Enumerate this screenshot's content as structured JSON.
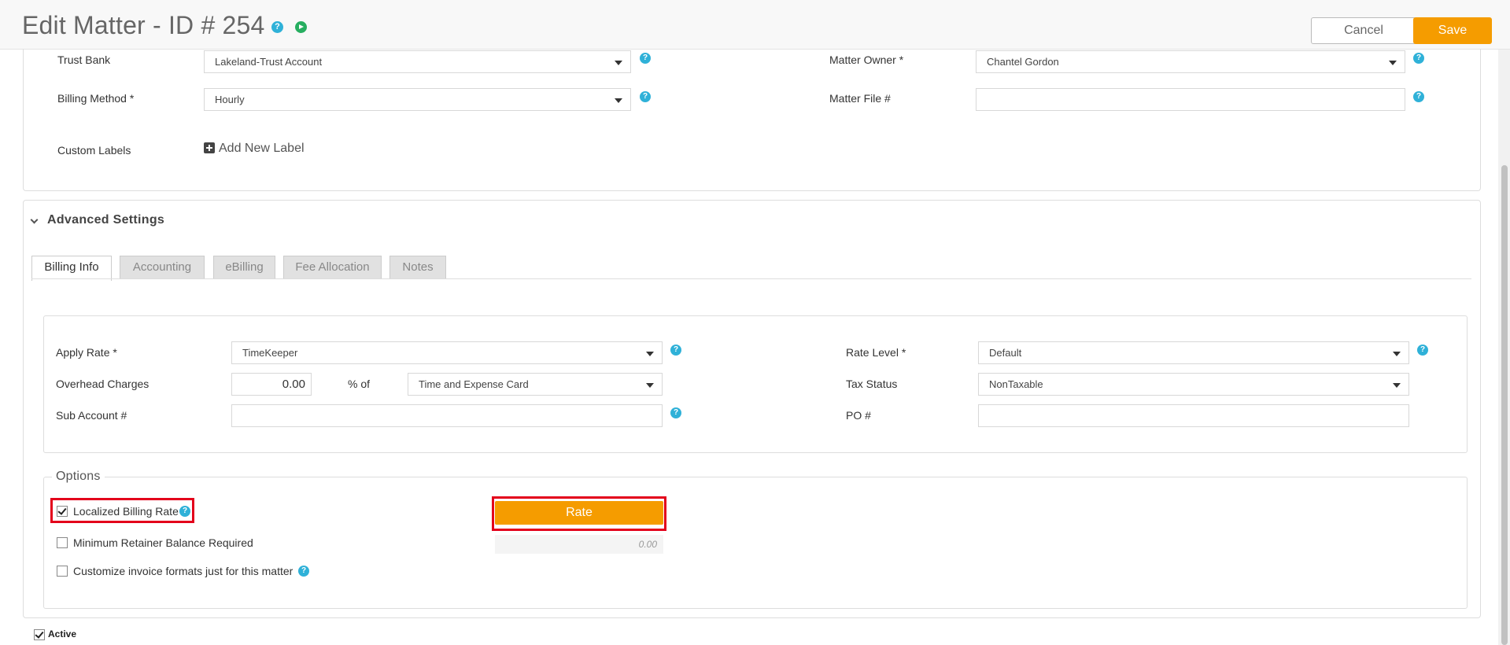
{
  "header": {
    "title": "Edit Matter - ID # 254",
    "cancel_label": "Cancel",
    "save_label": "Save",
    "help_glyph": "?"
  },
  "general": {
    "trust_bank": {
      "label": "Trust Bank",
      "value": "Lakeland-Trust Account"
    },
    "billing_method": {
      "label": "Billing Method *",
      "value": "Hourly"
    },
    "custom_labels": {
      "label": "Custom Labels",
      "add_label": "Add New Label"
    },
    "matter_owner": {
      "label": "Matter Owner *",
      "value": "Chantel Gordon"
    },
    "matter_file": {
      "label": "Matter File #",
      "value": ""
    }
  },
  "advanced": {
    "title": "Advanced Settings",
    "tabs": [
      {
        "label": "Billing Info",
        "active": true
      },
      {
        "label": "Accounting",
        "active": false
      },
      {
        "label": "eBilling",
        "active": false
      },
      {
        "label": "Fee Allocation",
        "active": false
      },
      {
        "label": "Notes",
        "active": false
      }
    ],
    "billing": {
      "apply_rate": {
        "label": "Apply Rate *",
        "value": "TimeKeeper"
      },
      "overhead": {
        "label": "Overhead Charges",
        "value": "0.00",
        "pct_of": "% of",
        "basis": "Time and Expense Card"
      },
      "sub_account": {
        "label": "Sub Account #",
        "value": ""
      },
      "rate_level": {
        "label": "Rate Level *",
        "value": "Default"
      },
      "tax_status": {
        "label": "Tax Status",
        "value": "NonTaxable"
      },
      "po": {
        "label": "PO #",
        "value": ""
      }
    },
    "options": {
      "legend": "Options",
      "localized_billing_rate": {
        "label": "Localized Billing Rate",
        "checked": true
      },
      "min_retainer": {
        "label": "Minimum Retainer Balance Required",
        "checked": false
      },
      "customize_invoice": {
        "label": "Customize invoice formats just for this matter",
        "checked": false
      },
      "rate_button": "Rate",
      "min_retainer_value": "0.00"
    }
  },
  "footer": {
    "active_label": "Active",
    "active_checked": true
  },
  "colors": {
    "accent": "#f59c00",
    "help": "#2fb1d8",
    "highlight": "#e3001b"
  }
}
